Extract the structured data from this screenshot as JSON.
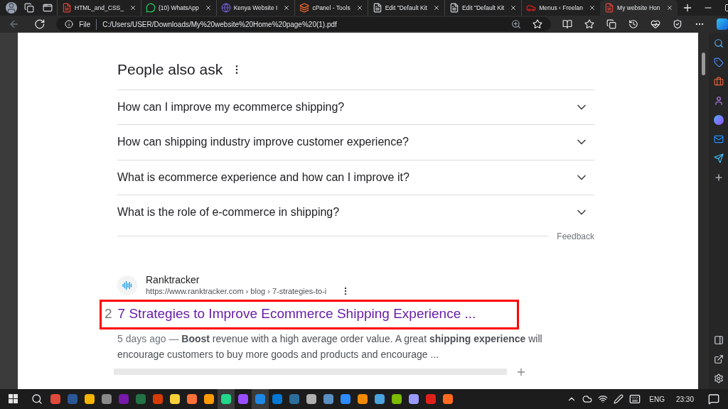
{
  "tabs": [
    {
      "title": "HTML_and_CSS_",
      "kind": "pdf",
      "selected": false
    },
    {
      "title": "(10) WhatsApp",
      "kind": "chat",
      "selected": false
    },
    {
      "title": "Kenya Website I",
      "kind": "globe",
      "selected": false
    },
    {
      "title": "cPanel - Tools",
      "kind": "cp",
      "selected": false
    },
    {
      "title": "Edit \"Default Kit",
      "kind": "page",
      "selected": false
    },
    {
      "title": "Edit \"Default Kit",
      "kind": "page",
      "selected": false
    },
    {
      "title": "Menus ‹ Freelan",
      "kind": "car",
      "selected": false
    },
    {
      "title": "My website Hon",
      "kind": "pdf",
      "selected": true
    }
  ],
  "address": {
    "scheme": "File",
    "url": "C:/Users/USER/Downloads/My%20website%20Home%20page%20(1).pdf"
  },
  "people_also_ask": {
    "title": "People also ask",
    "questions": [
      {
        "text": "How can I improve my ecommerce shipping?",
        "expanded": false
      },
      {
        "text": "How can shipping industry improve customer experience?",
        "expanded": false
      },
      {
        "text": "What is ecommerce experience and how can I improve it?",
        "expanded": false
      },
      {
        "text": "What is the role of e-commerce in shipping?",
        "expanded": false
      }
    ],
    "feedback": "Feedback"
  },
  "result": {
    "source": "Ranktracker",
    "url": "https://www.ranktracker.com › blog › 7-strategies-to-i",
    "number": "2",
    "title": "7 Strategies to Improve Ecommerce Shipping Experience ...",
    "highlighted": true,
    "snippet_date": "5 days ago —",
    "snippet": "**Boost** revenue with a high average order value. A great **shipping experience** will encourage customers to buy more goods and products and encourage ..."
  },
  "taskbar": {
    "apps": [
      {
        "color": "#e04a3a",
        "active": false
      },
      {
        "color": "#2b5797",
        "active": false
      },
      {
        "color": "#f4b400",
        "active": false
      },
      {
        "color": "#8a8a8a",
        "active": false
      },
      {
        "color": "#7719aa",
        "active": false
      },
      {
        "color": "#217346",
        "active": false
      },
      {
        "color": "#d83b01",
        "active": false
      },
      {
        "color": "#f7d038",
        "active": false
      },
      {
        "color": "#ff7139",
        "active": false
      },
      {
        "color": "#ff9a00",
        "active": false
      },
      {
        "color": "#21d789",
        "active": true
      },
      {
        "color": "#9a4dff",
        "active": false
      },
      {
        "color": "#1e88e5",
        "active": true
      },
      {
        "color": "#0078d4",
        "active": false
      },
      {
        "color": "#2c6e9b",
        "active": false
      },
      {
        "color": "#b0b0b0",
        "active": false
      },
      {
        "color": "#5a8fc2",
        "active": false
      },
      {
        "color": "#2d8cff",
        "active": false
      },
      {
        "color": "#f08a00",
        "active": false
      },
      {
        "color": "#4aa3df",
        "active": false
      },
      {
        "color": "#7cbb00",
        "active": false
      },
      {
        "color": "#9999ff",
        "active": false
      },
      {
        "color": "#e0201b",
        "active": false
      },
      {
        "color": "#ff6a1f",
        "active": false
      }
    ],
    "language": "ENG",
    "time": "23:30"
  }
}
